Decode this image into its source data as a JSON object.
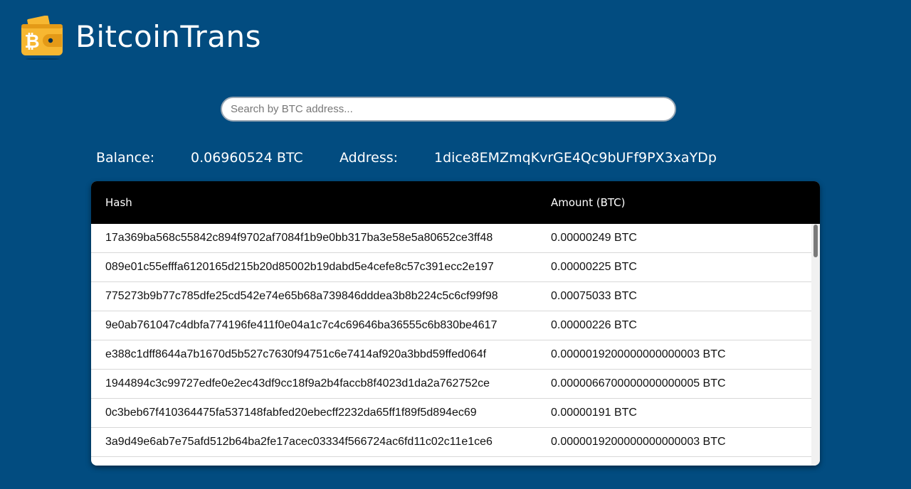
{
  "app": {
    "title": "BitcoinTrans",
    "logo_icon": "bitcoin-wallet-icon",
    "brand_color": "#f7b731"
  },
  "search": {
    "placeholder": "Search by BTC address...",
    "value": ""
  },
  "info": {
    "balance_label": "Balance:",
    "balance_value": "0.06960524 BTC",
    "address_label": "Address:",
    "address_value": "1dice8EMZmqKvrGE4Qc9bUFf9PX3xaYDp"
  },
  "table": {
    "columns": [
      "Hash",
      "Amount (BTC)"
    ],
    "rows": [
      {
        "hash": "17a369ba568c55842c894f9702af7084f1b9e0bb317ba3e58e5a80652ce3ff48",
        "amount": "0.00000249 BTC"
      },
      {
        "hash": "089e01c55efffa6120165d215b20d85002b19dabd5e4cefe8c57c391ecc2e197",
        "amount": "0.00000225 BTC"
      },
      {
        "hash": "775273b9b77c785dfe25cd542e74e65b68a739846dddea3b8b224c5c6cf99f98",
        "amount": "0.00075033 BTC"
      },
      {
        "hash": "9e0ab761047c4dbfa774196fe411f0e04a1c7c4c69646ba36555c6b830be4617",
        "amount": "0.00000226 BTC"
      },
      {
        "hash": "e388c1dff8644a7b1670d5b527c7630f94751c6e7414af920a3bbd59ffed064f",
        "amount": "0.0000019200000000000003 BTC"
      },
      {
        "hash": "1944894c3c99727edfe0e2ec43df9cc18f9a2b4faccb8f4023d1da2a762752ce",
        "amount": "0.0000066700000000000005 BTC"
      },
      {
        "hash": "0c3beb67f410364475fa537148fabfed20ebecff2232da65ff1f89f5d894ec69",
        "amount": "0.00000191 BTC"
      },
      {
        "hash": "3a9d49e6ab7e75afd512b64ba2fe17acec03334f566724ac6fd11c02c11e1ce6",
        "amount": "0.0000019200000000000003 BTC"
      },
      {
        "hash": "",
        "amount": ""
      }
    ]
  }
}
